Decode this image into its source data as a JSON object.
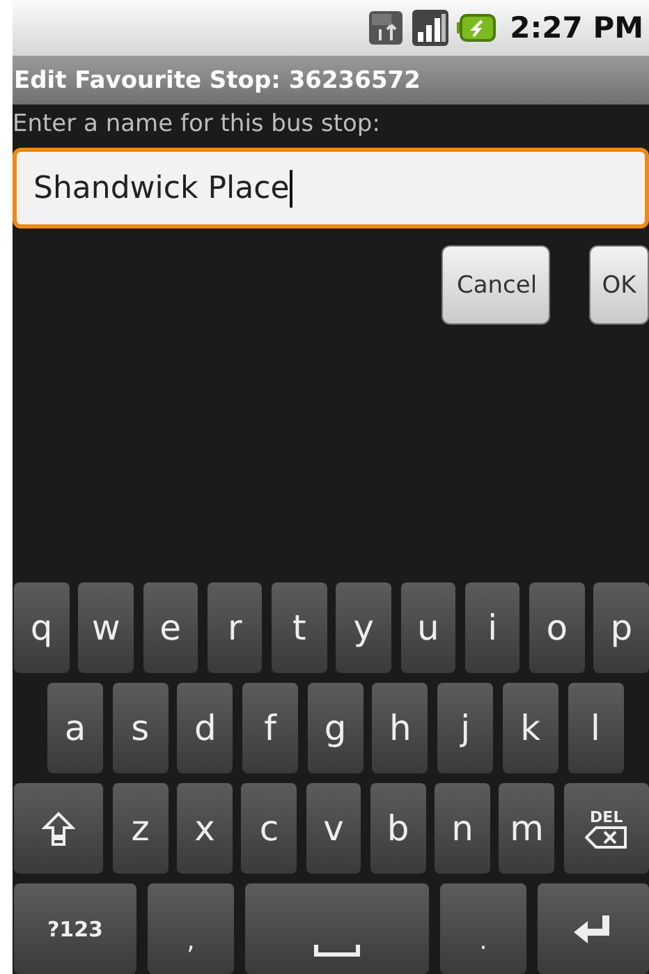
{
  "status_bar": {
    "time": "2:27 PM"
  },
  "dialog": {
    "title": "Edit Favourite Stop: 36236572",
    "prompt": "Enter a name for this bus stop:",
    "field": {
      "value": "Shandwick Place",
      "focused": true
    },
    "buttons": [
      "Cancel",
      "OK"
    ]
  },
  "keyboard": {
    "rows": [
      [
        {
          "kind": "letter",
          "label": "q"
        },
        {
          "kind": "letter",
          "label": "w"
        },
        {
          "kind": "letter",
          "label": "e"
        },
        {
          "kind": "letter",
          "label": "r"
        },
        {
          "kind": "letter",
          "label": "t"
        },
        {
          "kind": "letter",
          "label": "y"
        },
        {
          "kind": "letter",
          "label": "u"
        },
        {
          "kind": "letter",
          "label": "i"
        },
        {
          "kind": "letter",
          "label": "o"
        },
        {
          "kind": "letter",
          "label": "p"
        }
      ],
      [
        {
          "kind": "letter",
          "label": "a"
        },
        {
          "kind": "letter",
          "label": "s"
        },
        {
          "kind": "letter",
          "label": "d"
        },
        {
          "kind": "letter",
          "label": "f"
        },
        {
          "kind": "letter",
          "label": "g"
        },
        {
          "kind": "letter",
          "label": "h"
        },
        {
          "kind": "letter",
          "label": "j"
        },
        {
          "kind": "letter",
          "label": "k"
        },
        {
          "kind": "letter",
          "label": "l"
        }
      ],
      [
        {
          "kind": "shift"
        },
        {
          "kind": "letter",
          "label": "z"
        },
        {
          "kind": "letter",
          "label": "x"
        },
        {
          "kind": "letter",
          "label": "c"
        },
        {
          "kind": "letter",
          "label": "v"
        },
        {
          "kind": "letter",
          "label": "b"
        },
        {
          "kind": "letter",
          "label": "n"
        },
        {
          "kind": "letter",
          "label": "m"
        },
        {
          "kind": "delete",
          "label": "DEL"
        }
      ],
      [
        {
          "kind": "symbols",
          "label": "?123"
        },
        {
          "kind": "punct",
          "label": ","
        },
        {
          "kind": "space"
        },
        {
          "kind": "punct",
          "label": "."
        },
        {
          "kind": "enter"
        }
      ]
    ]
  }
}
